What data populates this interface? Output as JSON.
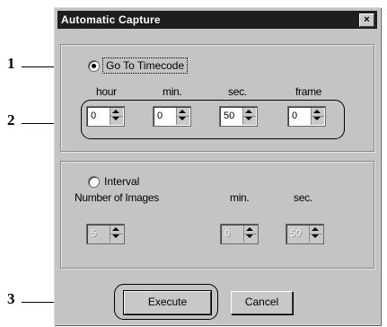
{
  "dialog": {
    "title": "Automatic Capture",
    "close_glyph": "×"
  },
  "goto_group": {
    "radio_label": "Go To Timecode",
    "selected": true,
    "headers": {
      "hour": "hour",
      "min": "min.",
      "sec": "sec.",
      "frame": "frame"
    },
    "values": {
      "hour": "0",
      "min": "0",
      "sec": "50",
      "frame": "0"
    }
  },
  "interval_group": {
    "radio_label": "Interval",
    "selected": false,
    "number_label": "Number of Images",
    "min_label": "min.",
    "sec_label": "sec.",
    "values": {
      "number": "5",
      "min": "0",
      "sec": "50"
    }
  },
  "buttons": {
    "execute": "Execute",
    "cancel": "Cancel"
  },
  "callouts": {
    "one": "1",
    "two": "2",
    "three": "3"
  }
}
